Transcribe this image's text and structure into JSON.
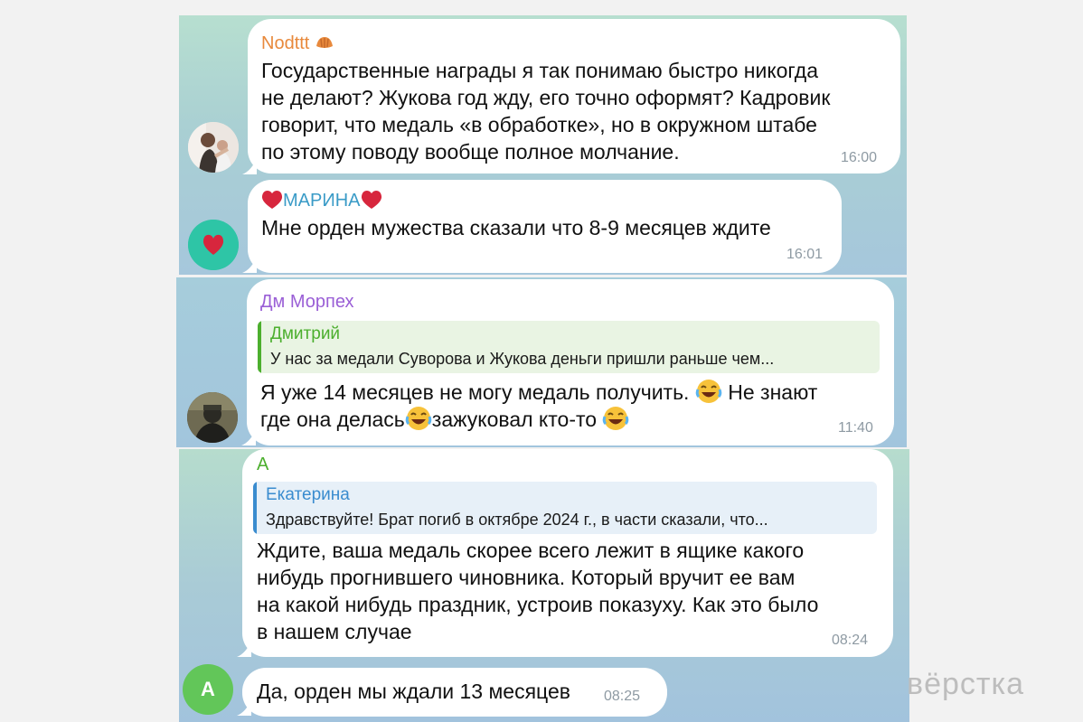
{
  "messages": [
    {
      "author": "Nodttt",
      "author_emoji": "croissant-emoji",
      "text_lines": [
        "Государственные награды я так понимаю быстро никогда",
        "не делают? Жукова год жду, его точно оформят? Кадровик",
        "говорит, что медаль «в обработке», но в окружном штабе",
        "по этому поводу вообще полное молчание."
      ],
      "time": "16:00",
      "name_color": "#e8893c"
    },
    {
      "author": "МАРИНА",
      "author_emoji": "heart-emoji",
      "text_lines": [
        "Мне орден мужества сказали что 8-9 месяцев ждите"
      ],
      "time": "16:01",
      "name_color": "#3a9bc7"
    },
    {
      "author": "Дм Морпех",
      "reply": {
        "author": "Дмитрий",
        "text": "У нас за медали Суворова и Жукова деньги пришли раньше чем..."
      },
      "text_lines": [
        "Я уже 14 месяцев не могу медаль получить.",
        "Не знают",
        "где она делась",
        "зажуковал кто-то"
      ],
      "time": "11:40",
      "name_color": "#9a5fd6",
      "reply_color": "#4caf2e"
    },
    {
      "author": "А",
      "reply": {
        "author": "Екатерина",
        "text": "Здравствуйте! Брат погиб в октябре 2024 г., в части сказали, что..."
      },
      "text_lines": [
        "Ждите, ваша медаль скорее всего лежит в ящике какого",
        "нибудь прогнившего чиновника. Который вручит ее вам",
        "на какой нибудь праздник, устроив показуху. Как это было",
        "в нашем случае"
      ],
      "time": "08:24",
      "name_color": "#4caf2e",
      "reply_color": "#3a8ccf"
    },
    {
      "text_lines": [
        "Да, орден мы ждали 13 месяцев"
      ],
      "time": "08:25",
      "avatar_letter": "А"
    }
  ],
  "watermark": "вёрстка"
}
